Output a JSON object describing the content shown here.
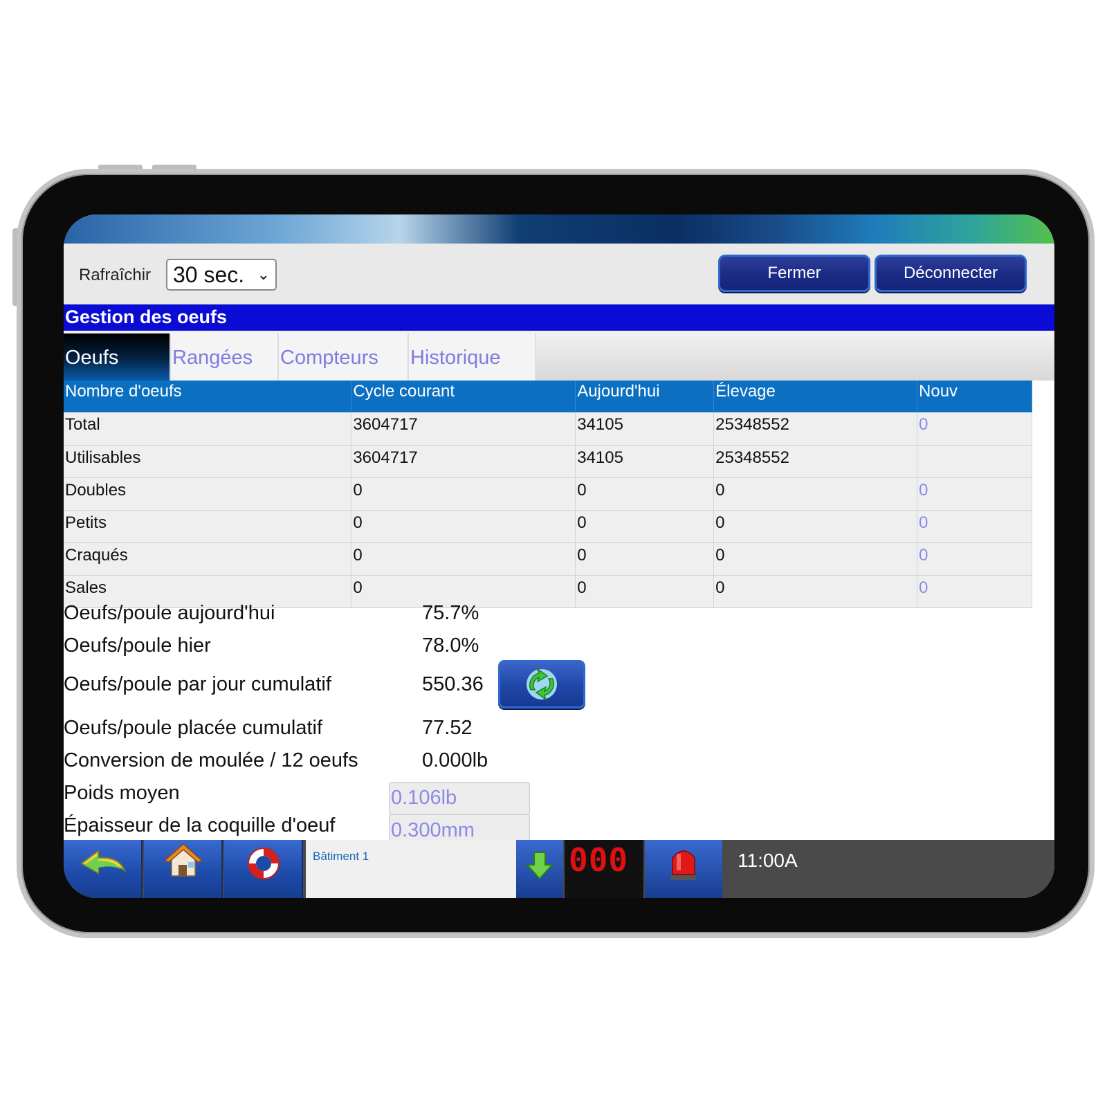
{
  "toolbar": {
    "refresh_label": "Rafraîchir",
    "refresh_value": "30 sec.",
    "close_label": "Fermer",
    "logout_label": "Déconnecter"
  },
  "section_title": "Gestion des oeufs",
  "tabs": [
    {
      "label": "Oeufs",
      "active": true
    },
    {
      "label": "Rangées",
      "active": false
    },
    {
      "label": "Compteurs",
      "active": false
    },
    {
      "label": "Historique",
      "active": false
    }
  ],
  "table": {
    "headers": [
      "Nombre d'oeufs",
      "Cycle courant",
      "Aujourd'hui",
      "Élevage",
      "Nouv"
    ],
    "rows": [
      [
        "Total",
        "3604717",
        "34105",
        "25348552",
        "0"
      ],
      [
        "Utilisables",
        "3604717",
        "34105",
        "25348552",
        ""
      ],
      [
        "Doubles",
        "0",
        "0",
        "0",
        "0"
      ],
      [
        "Petits",
        "0",
        "0",
        "0",
        "0"
      ],
      [
        "Craqués",
        "0",
        "0",
        "0",
        "0"
      ],
      [
        "Sales",
        "0",
        "0",
        "0",
        "0"
      ]
    ]
  },
  "stats": {
    "today_label": "Oeufs/poule aujourd'hui",
    "today_value": "75.7%",
    "yesterday_label": "Oeufs/poule hier",
    "yesterday_value": "78.0%",
    "cumulative_day_label": "Oeufs/poule par jour cumulatif",
    "cumulative_day_value": "550.36",
    "cumulative_placed_label": "Oeufs/poule placée cumulatif",
    "cumulative_placed_value": "77.52",
    "feed_conversion_label": "Conversion de moulée / 12 oeufs",
    "feed_conversion_value": "0.000lb",
    "avg_weight_label": "Poids moyen",
    "avg_weight_value": "0.106lb",
    "shell_label": "Épaisseur de la coquille d'oeuf",
    "shell_value": "0.300mm"
  },
  "bottom": {
    "building": "Bâtiment 1",
    "counter": "000",
    "time": "11:00A"
  },
  "icons": {
    "back": "back-arrow-icon",
    "home": "home-icon",
    "help": "lifebuoy-icon",
    "download": "down-arrow-icon",
    "alarm": "alarm-beacon-icon",
    "recalc": "recycle-arrows-icon"
  }
}
